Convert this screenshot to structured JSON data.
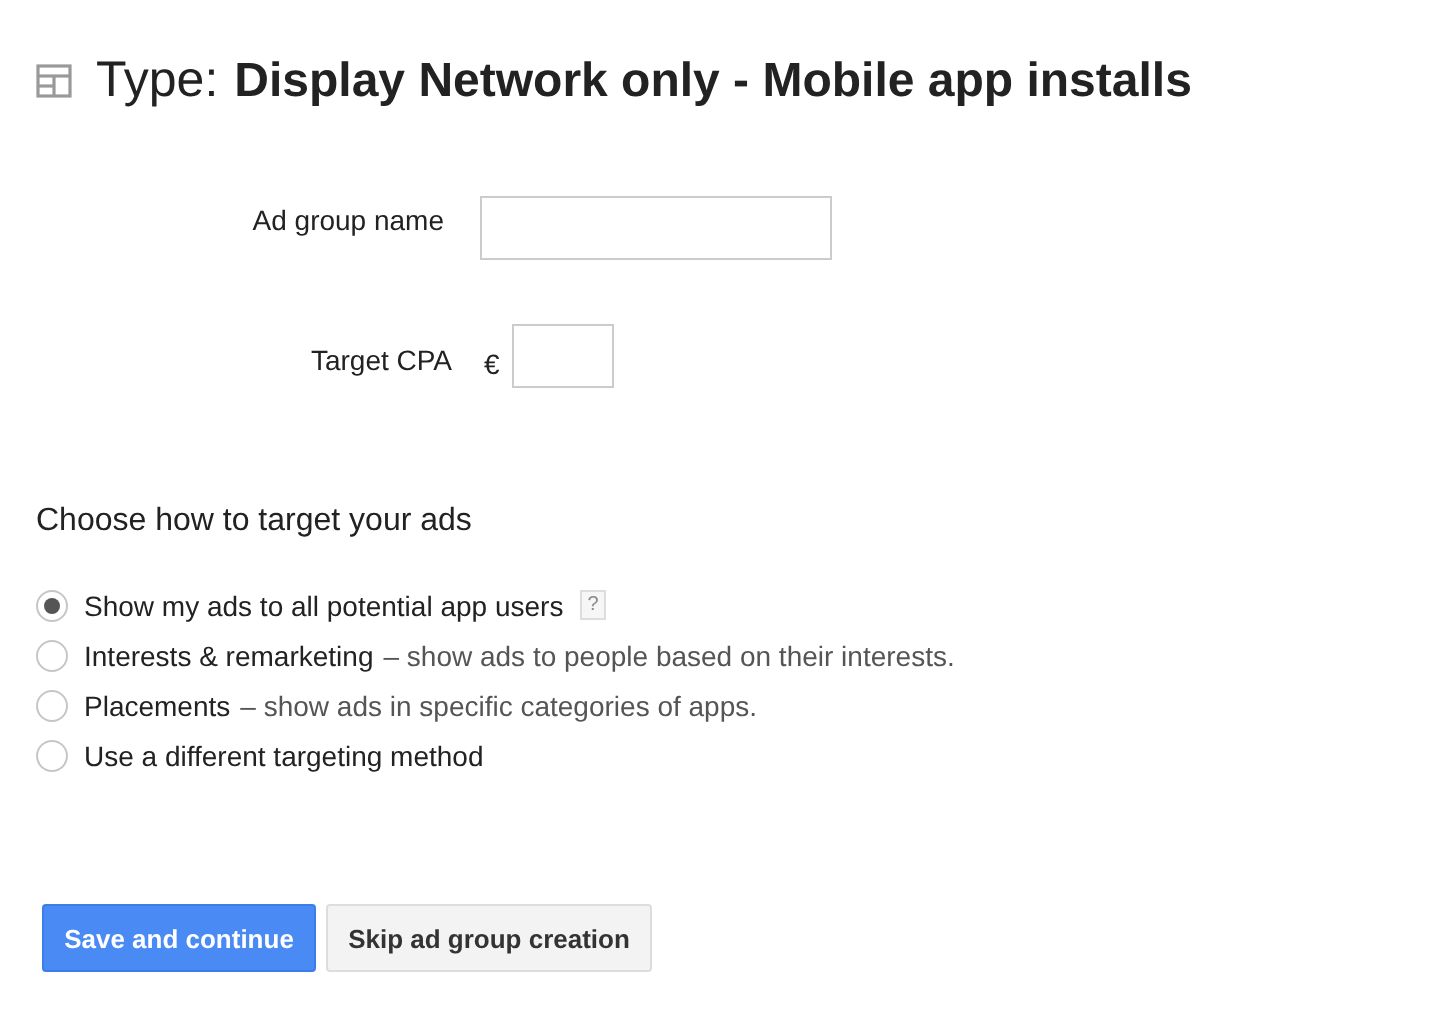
{
  "header": {
    "label": "Type:",
    "value": "Display Network only - Mobile app installs"
  },
  "fields": [
    {
      "kind": "text",
      "label": "Ad group name"
    },
    {
      "kind": "currency",
      "label": "Target CPA",
      "prefix": "€"
    }
  ],
  "targeting": {
    "heading": "Choose how to target your ads",
    "options": [
      {
        "label": "Show my ads to all potential app users",
        "help": "?",
        "selected": true
      },
      {
        "label": "Interests & remarketing",
        "description": "– show ads to people based on their interests.",
        "selected": false
      },
      {
        "label": "Placements",
        "description": "– show ads in specific categories of apps.",
        "selected": false
      },
      {
        "label": "Use a different targeting method",
        "selected": false
      }
    ]
  },
  "buttons": [
    {
      "kind": "primary",
      "label": "Save and continue"
    },
    {
      "kind": "secondary",
      "label": "Skip ad group creation"
    }
  ]
}
